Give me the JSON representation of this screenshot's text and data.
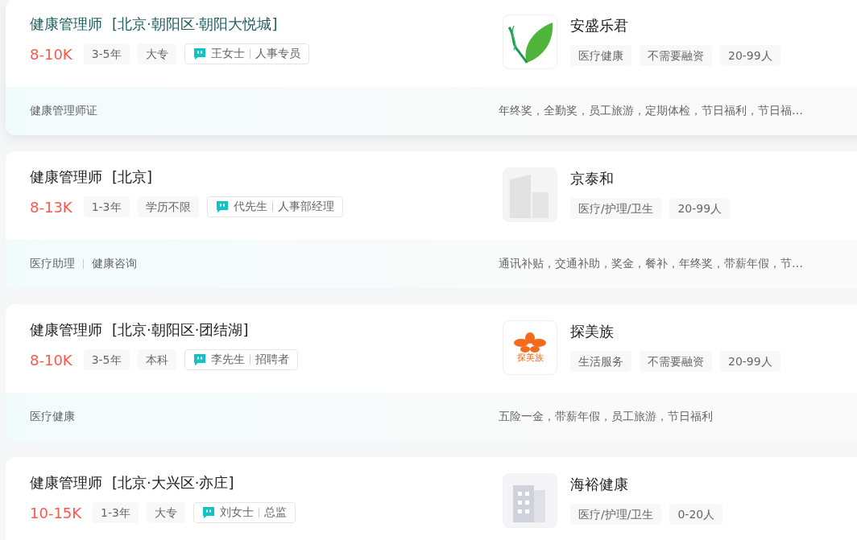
{
  "jobs": [
    {
      "highlighted": true,
      "title": "健康管理师",
      "location": "[北京·朝阳区·朝阳大悦城]",
      "salary": "8-10K",
      "requirements": [
        "3-5年",
        "大专"
      ],
      "recruiter": {
        "name": "王女士",
        "role": "人事专员"
      },
      "company": {
        "name": "安盛乐君",
        "logo": {
          "kind": "leaf"
        },
        "tags": [
          "医疗健康",
          "不需要融资",
          "20-99人"
        ]
      },
      "skills": [
        "健康管理师证"
      ],
      "benefits": "年终奖，全勤奖，员工旅游，定期体检，节日福利，节日福…"
    },
    {
      "highlighted": false,
      "title": "健康管理师",
      "location": "[北京]",
      "salary": "8-13K",
      "requirements": [
        "1-3年",
        "学历不限"
      ],
      "recruiter": {
        "name": "代先生",
        "role": "人事部经理"
      },
      "company": {
        "name": "京泰和",
        "logo": {
          "kind": "building"
        },
        "tags": [
          "医疗/护理/卫生",
          "20-99人"
        ]
      },
      "skills": [
        "医疗助理",
        "健康咨询"
      ],
      "benefits": "通讯补贴，交通补助，奖金，餐补，年终奖，带薪年假，节…"
    },
    {
      "highlighted": false,
      "title": "健康管理师",
      "location": "[北京·朝阳区·团结湖]",
      "salary": "8-10K",
      "requirements": [
        "3-5年",
        "本科"
      ],
      "recruiter": {
        "name": "李先生",
        "role": "招聘者"
      },
      "company": {
        "name": "探美族",
        "logo": {
          "kind": "flower",
          "text": "探美族"
        },
        "tags": [
          "生活服务",
          "不需要融资",
          "20-99人"
        ]
      },
      "skills": [
        "医疗健康"
      ],
      "benefits": "五险一金，带薪年假，员工旅游，节日福利"
    },
    {
      "highlighted": false,
      "title": "健康管理师",
      "location": "[北京·大兴区·亦庄]",
      "salary": "10-15K",
      "requirements": [
        "1-3年",
        "大专"
      ],
      "recruiter": {
        "name": "刘女士",
        "role": "总监"
      },
      "company": {
        "name": "海裕健康",
        "logo": {
          "kind": "tower"
        },
        "tags": [
          "医疗/护理/卫生",
          "0-20人"
        ]
      }
    }
  ]
}
